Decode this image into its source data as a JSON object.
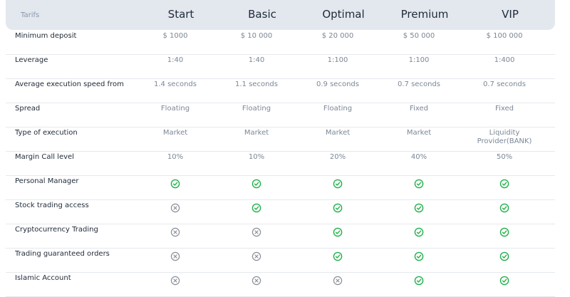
{
  "header": {
    "label": "Tarifs",
    "plans": [
      "Start",
      "Basic",
      "Optimal",
      "Premium",
      "VIP"
    ]
  },
  "rows": [
    {
      "label": "Minimum deposit",
      "values": [
        "$ 1000",
        "$ 10 000",
        "$ 20 000",
        "$ 50 000",
        "$ 100 000"
      ]
    },
    {
      "label": "Leverage",
      "values": [
        "1:40",
        "1:40",
        "1:100",
        "1:100",
        "1:400"
      ]
    },
    {
      "label": "Average execution speed from",
      "values": [
        "1.4 seconds",
        "1.1 seconds",
        "0.9 seconds",
        "0.7 seconds",
        "0.7 seconds"
      ]
    },
    {
      "label": "Spread",
      "values": [
        "Floating",
        "Floating",
        "Floating",
        "Fixed",
        "Fixed"
      ]
    },
    {
      "label": "Type of execution",
      "values": [
        "Market",
        "Market",
        "Market",
        "Market",
        "Liquidity Provider(BANK)"
      ]
    },
    {
      "label": "Margin Call level",
      "values": [
        "10%",
        "10%",
        "20%",
        "40%",
        "50%"
      ]
    },
    {
      "label": "Personal Manager",
      "icons": [
        "check",
        "check",
        "check",
        "check",
        "check"
      ]
    },
    {
      "label": "Stock trading access",
      "icons": [
        "cross",
        "check",
        "check",
        "check",
        "check"
      ]
    },
    {
      "label": "Cryptocurrency Trading",
      "icons": [
        "cross",
        "cross",
        "check",
        "check",
        "check"
      ]
    },
    {
      "label": "Trading guaranteed orders",
      "icons": [
        "cross",
        "cross",
        "check",
        "check",
        "check"
      ]
    },
    {
      "label": "Islamic Account",
      "icons": [
        "cross",
        "cross",
        "cross",
        "check",
        "check"
      ]
    }
  ],
  "colors": {
    "check": "#22b14c",
    "cross": "#8a8f98",
    "header_bg": "#e3e8ef"
  }
}
